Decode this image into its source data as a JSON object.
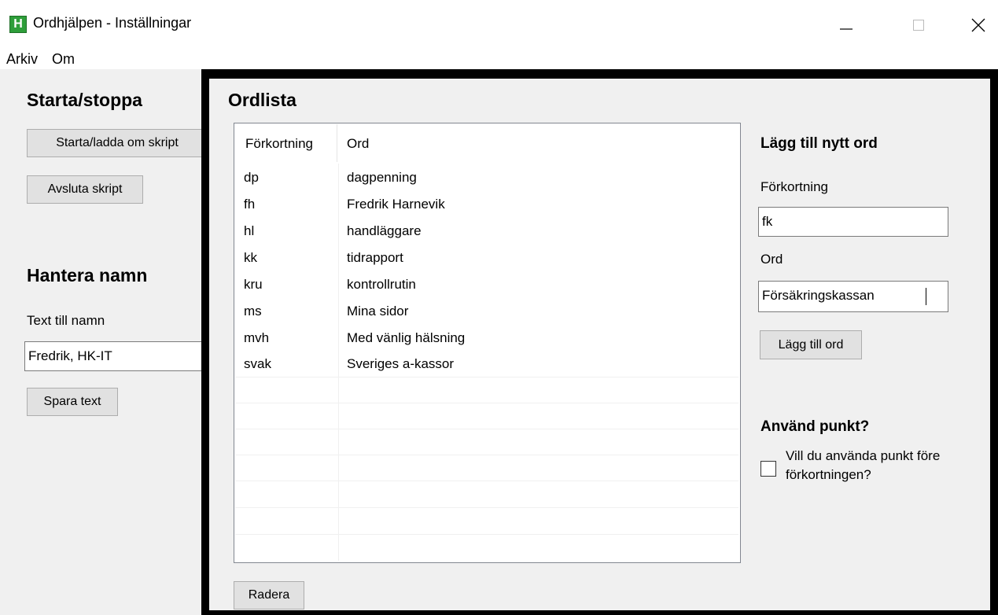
{
  "window": {
    "app_icon_letter": "H",
    "title": "Ordhjälpen - Inställningar"
  },
  "menu": {
    "items": [
      "Arkiv",
      "Om"
    ]
  },
  "left": {
    "start_heading": "Starta/stoppa",
    "start_button": "Starta/ladda om skript",
    "stop_button": "Avsluta skript",
    "name_heading": "Hantera namn",
    "name_label": "Text till namn",
    "name_value": "Fredrik, HK-IT",
    "save_button": "Spara text"
  },
  "wordlist": {
    "heading": "Ordlista",
    "columns": [
      "Förkortning",
      "Ord"
    ],
    "rows": [
      {
        "abbr": "dp",
        "word": "dagpenning"
      },
      {
        "abbr": "fh",
        "word": "Fredrik Harnevik"
      },
      {
        "abbr": "hl",
        "word": "handläggare"
      },
      {
        "abbr": "kk",
        "word": "tidrapport"
      },
      {
        "abbr": "kru",
        "word": "kontrollrutin"
      },
      {
        "abbr": "ms",
        "word": "Mina sidor"
      },
      {
        "abbr": "mvh",
        "word": "Med vänlig hälsning"
      },
      {
        "abbr": "svak",
        "word": "Sveriges a-kassor"
      }
    ],
    "delete_button": "Radera"
  },
  "add_word": {
    "heading": "Lägg till nytt ord",
    "abbr_label": "Förkortning",
    "abbr_value": "fk",
    "word_label": "Ord",
    "word_value": "Försäkringskassan",
    "add_button": "Lägg till ord"
  },
  "dot": {
    "heading": "Använd punkt?",
    "checkbox_label_line1": "Vill du använda punkt före",
    "checkbox_label_line2": "förkortningen?",
    "checked": false
  },
  "colors": {
    "client_bg": "#f0f0f0",
    "border_black": "#000000",
    "button_bg": "#e1e1e1",
    "icon_green": "#2e9e3a"
  }
}
